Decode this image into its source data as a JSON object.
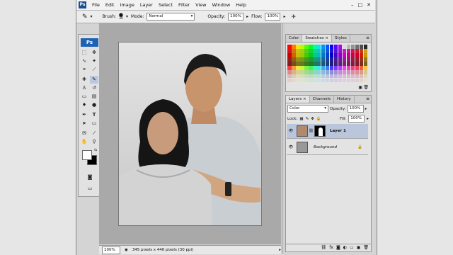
{
  "menubar": {
    "items": [
      "File",
      "Edit",
      "Image",
      "Layer",
      "Select",
      "Filter",
      "View",
      "Window",
      "Help"
    ],
    "win_controls": [
      "–",
      "□",
      "✕"
    ]
  },
  "options": {
    "brush_label": "Brush:",
    "brush_size": "36",
    "mode_label": "Mode:",
    "mode_value": "Normal",
    "opacity_label": "Opacity:",
    "opacity_value": "100%",
    "flow_label": "Flow:",
    "flow_value": "100%"
  },
  "toolbox": {
    "logo": "Ps"
  },
  "status": {
    "zoom": "100%",
    "info": "345 pixels x 446 pixels (30 ppi)"
  },
  "swatches_panel": {
    "tabs": [
      "Color",
      "Swatches ×",
      "Styles"
    ]
  },
  "layers_panel": {
    "tabs": [
      "Layers ×",
      "Channels",
      "History"
    ],
    "blend_mode": "Color",
    "opacity_label": "Opacity:",
    "opacity_value": "100%",
    "lock_label": "Lock:",
    "fill_label": "Fill:",
    "fill_value": "100%",
    "layers": [
      {
        "name": "Layer 1"
      },
      {
        "name": "Background"
      }
    ]
  },
  "colors": {
    "fg": "#000000",
    "bg": "#ffffff",
    "layer1_thumb": "#b08a6a",
    "selected_layer": "#b9c6dc",
    "ps_blue": "#1d62b5"
  }
}
